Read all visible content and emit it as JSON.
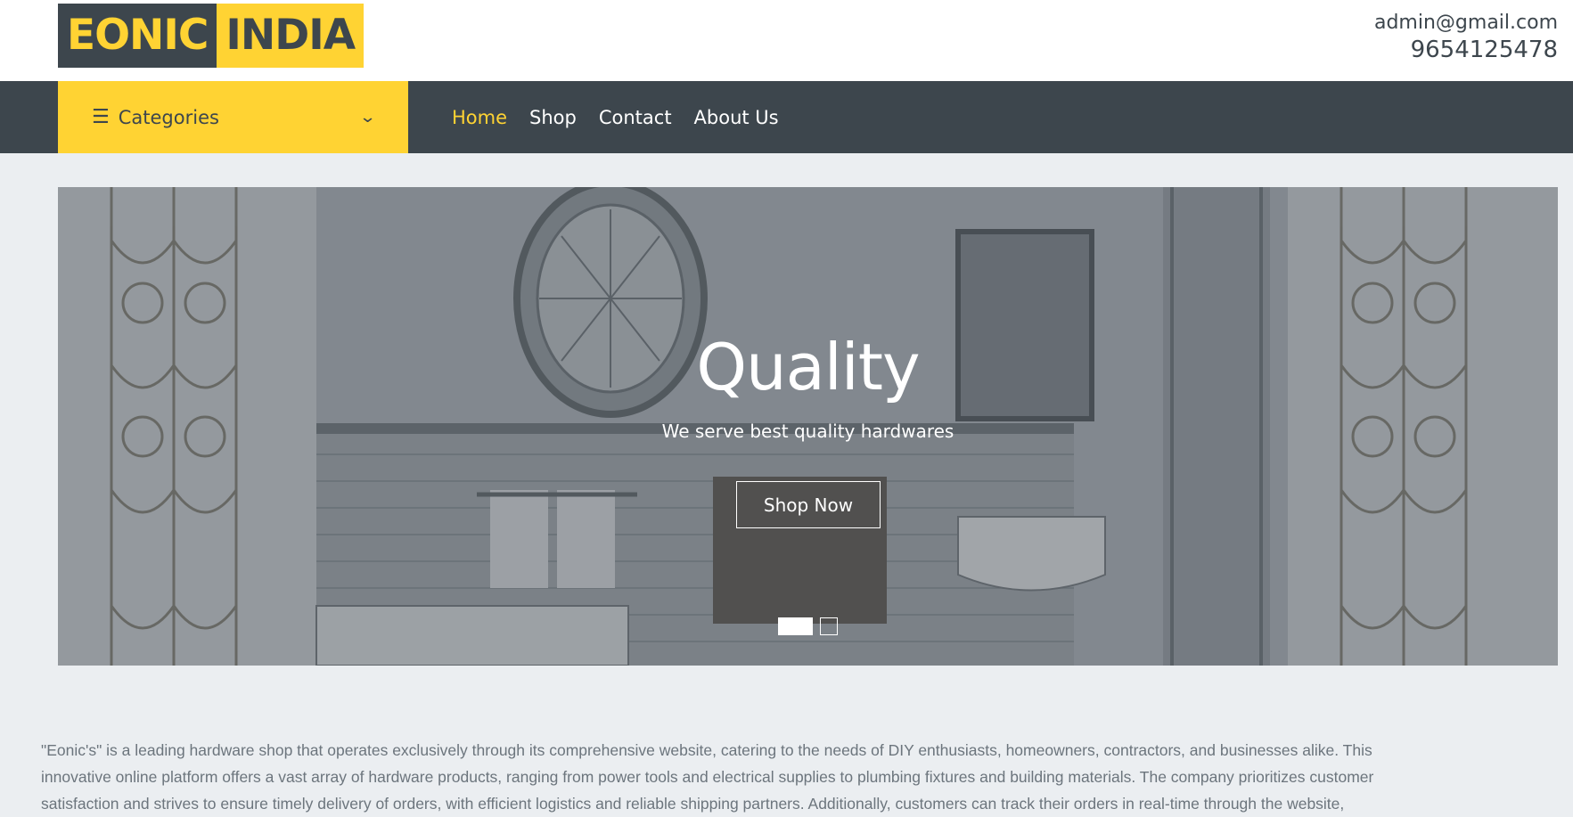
{
  "header": {
    "logo_part1": "EONIC",
    "logo_part2": "INDIA",
    "email": "admin@gmail.com",
    "phone": "9654125478"
  },
  "nav": {
    "categories_label": "Categories",
    "links": [
      "Home",
      "Shop",
      "Contact",
      "About Us"
    ],
    "active": "Home"
  },
  "hero": {
    "title": "Quality",
    "subtitle": "We serve best quality hardwares",
    "button": "Shop Now",
    "slides": 2,
    "active_slide": 1
  },
  "description": {
    "lines": [
      "\"Eonic's\" is a leading hardware shop that operates exclusively through its comprehensive website, catering to the needs of DIY enthusiasts, homeowners, contractors, and businesses alike. This",
      "innovative online platform offers a vast array of hardware products, ranging from power tools and electrical supplies to plumbing fixtures and building materials. The company prioritizes customer",
      "satisfaction and strives to ensure timely delivery of orders, with efficient logistics and reliable shipping partners. Additionally, customers can track their orders in real-time through the website,"
    ]
  },
  "colors": {
    "accent": "#ffd333",
    "dark": "#3d464d",
    "background": "#ebeef1",
    "text_muted": "#6c757d"
  },
  "icons": {
    "menu": "bars-icon",
    "dropdown": "chevron-down-icon"
  }
}
